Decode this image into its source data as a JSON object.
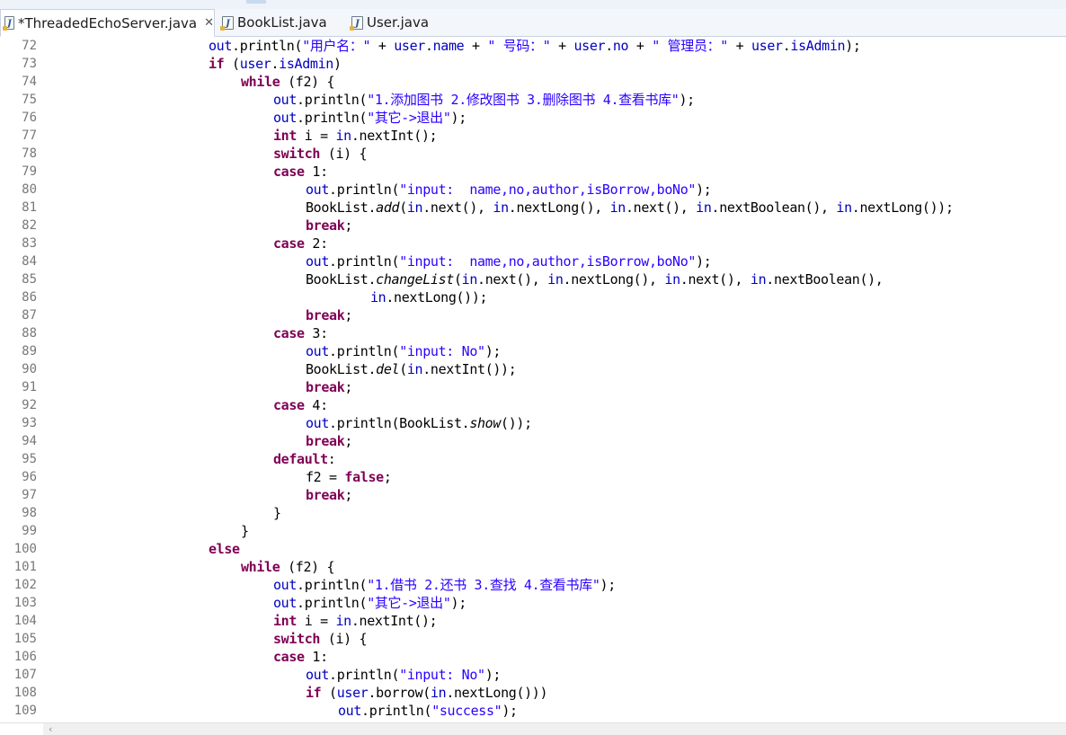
{
  "tabs": [
    {
      "label": "*ThreadedEchoServer.java",
      "active": true,
      "closable": true
    },
    {
      "label": "BookList.java",
      "active": false,
      "closable": false
    },
    {
      "label": "User.java",
      "active": false,
      "closable": false
    }
  ],
  "colors": {
    "keyword": "#7f0055",
    "field": "#0000c0",
    "string": "#2a00ff",
    "line_number": "#787878"
  },
  "lines": [
    {
      "n": "72",
      "indent": 5,
      "t": [
        [
          "out",
          "f"
        ],
        [
          ".println("
        ],
        [
          "\"用户名：\"",
          "s"
        ],
        [
          " + "
        ],
        [
          "user",
          "f"
        ],
        [
          "."
        ],
        [
          "name",
          "f"
        ],
        [
          " + "
        ],
        [
          "\" 号码：\"",
          "s"
        ],
        [
          " + "
        ],
        [
          "user",
          "f"
        ],
        [
          "."
        ],
        [
          "no",
          "f"
        ],
        [
          " + "
        ],
        [
          "\" 管理员：\"",
          "s"
        ],
        [
          " + "
        ],
        [
          "user",
          "f"
        ],
        [
          "."
        ],
        [
          "isAdmin",
          "f"
        ],
        [
          ");"
        ]
      ]
    },
    {
      "n": "73",
      "indent": 5,
      "t": [
        [
          "if",
          "k"
        ],
        [
          " ("
        ],
        [
          "user",
          "f"
        ],
        [
          "."
        ],
        [
          "isAdmin",
          "f"
        ],
        [
          ")"
        ]
      ]
    },
    {
      "n": "74",
      "indent": 6,
      "t": [
        [
          "while",
          "k"
        ],
        [
          " (f2) {"
        ]
      ]
    },
    {
      "n": "75",
      "indent": 7,
      "t": [
        [
          "out",
          "f"
        ],
        [
          ".println("
        ],
        [
          "\"1.添加图书 2.修改图书 3.删除图书 4.查看书库\"",
          "s"
        ],
        [
          ");"
        ]
      ]
    },
    {
      "n": "76",
      "indent": 7,
      "t": [
        [
          "out",
          "f"
        ],
        [
          ".println("
        ],
        [
          "\"其它->退出\"",
          "s"
        ],
        [
          ");"
        ]
      ]
    },
    {
      "n": "77",
      "indent": 7,
      "t": [
        [
          "int",
          "k"
        ],
        [
          " i = "
        ],
        [
          "in",
          "f"
        ],
        [
          ".nextInt();"
        ]
      ]
    },
    {
      "n": "78",
      "indent": 7,
      "t": [
        [
          "switch",
          "k"
        ],
        [
          " (i) {"
        ]
      ]
    },
    {
      "n": "79",
      "indent": 7,
      "t": [
        [
          "case",
          "k"
        ],
        [
          " 1:"
        ]
      ]
    },
    {
      "n": "80",
      "indent": 8,
      "t": [
        [
          "out",
          "f"
        ],
        [
          ".println("
        ],
        [
          "\"input:  name,no,author,isBorrow,boNo\"",
          "s"
        ],
        [
          ");"
        ]
      ]
    },
    {
      "n": "81",
      "indent": 8,
      "t": [
        [
          "BookList."
        ],
        [
          "add",
          "i"
        ],
        [
          "("
        ],
        [
          "in",
          "f"
        ],
        [
          ".next(), "
        ],
        [
          "in",
          "f"
        ],
        [
          ".nextLong(), "
        ],
        [
          "in",
          "f"
        ],
        [
          ".next(), "
        ],
        [
          "in",
          "f"
        ],
        [
          ".nextBoolean(), "
        ],
        [
          "in",
          "f"
        ],
        [
          ".nextLong());"
        ]
      ]
    },
    {
      "n": "82",
      "indent": 8,
      "t": [
        [
          "break",
          "k"
        ],
        [
          ";"
        ]
      ]
    },
    {
      "n": "83",
      "indent": 7,
      "t": [
        [
          "case",
          "k"
        ],
        [
          " 2:"
        ]
      ]
    },
    {
      "n": "84",
      "indent": 8,
      "t": [
        [
          "out",
          "f"
        ],
        [
          ".println("
        ],
        [
          "\"input:  name,no,author,isBorrow,boNo\"",
          "s"
        ],
        [
          ");"
        ]
      ]
    },
    {
      "n": "85",
      "indent": 8,
      "t": [
        [
          "BookList."
        ],
        [
          "changeList",
          "i"
        ],
        [
          "("
        ],
        [
          "in",
          "f"
        ],
        [
          ".next(), "
        ],
        [
          "in",
          "f"
        ],
        [
          ".nextLong(), "
        ],
        [
          "in",
          "f"
        ],
        [
          ".next(), "
        ],
        [
          "in",
          "f"
        ],
        [
          ".nextBoolean(),"
        ]
      ]
    },
    {
      "n": "86",
      "indent": 10,
      "t": [
        [
          "in",
          "f"
        ],
        [
          ".nextLong());"
        ]
      ]
    },
    {
      "n": "87",
      "indent": 8,
      "t": [
        [
          "break",
          "k"
        ],
        [
          ";"
        ]
      ]
    },
    {
      "n": "88",
      "indent": 7,
      "t": [
        [
          "case",
          "k"
        ],
        [
          " 3:"
        ]
      ]
    },
    {
      "n": "89",
      "indent": 8,
      "t": [
        [
          "out",
          "f"
        ],
        [
          ".println("
        ],
        [
          "\"input: No\"",
          "s"
        ],
        [
          ");"
        ]
      ]
    },
    {
      "n": "90",
      "indent": 8,
      "t": [
        [
          "BookList."
        ],
        [
          "del",
          "i"
        ],
        [
          "("
        ],
        [
          "in",
          "f"
        ],
        [
          ".nextInt());"
        ]
      ]
    },
    {
      "n": "91",
      "indent": 8,
      "t": [
        [
          "break",
          "k"
        ],
        [
          ";"
        ]
      ]
    },
    {
      "n": "92",
      "indent": 7,
      "t": [
        [
          "case",
          "k"
        ],
        [
          " 4:"
        ]
      ]
    },
    {
      "n": "93",
      "indent": 8,
      "t": [
        [
          "out",
          "f"
        ],
        [
          ".println(BookList."
        ],
        [
          "show",
          "i"
        ],
        [
          "());"
        ]
      ]
    },
    {
      "n": "94",
      "indent": 8,
      "t": [
        [
          "break",
          "k"
        ],
        [
          ";"
        ]
      ]
    },
    {
      "n": "95",
      "indent": 7,
      "t": [
        [
          "default",
          "k"
        ],
        [
          ":"
        ]
      ]
    },
    {
      "n": "96",
      "indent": 8,
      "t": [
        [
          "f2 = "
        ],
        [
          "false",
          "k"
        ],
        [
          ";"
        ]
      ]
    },
    {
      "n": "97",
      "indent": 8,
      "t": [
        [
          "break",
          "k"
        ],
        [
          ";"
        ]
      ]
    },
    {
      "n": "98",
      "indent": 7,
      "t": [
        [
          "}"
        ]
      ]
    },
    {
      "n": "99",
      "indent": 6,
      "t": [
        [
          "}"
        ]
      ]
    },
    {
      "n": "100",
      "indent": 5,
      "t": [
        [
          "else",
          "k"
        ]
      ]
    },
    {
      "n": "101",
      "indent": 6,
      "t": [
        [
          "while",
          "k"
        ],
        [
          " (f2) {"
        ]
      ]
    },
    {
      "n": "102",
      "indent": 7,
      "t": [
        [
          "out",
          "f"
        ],
        [
          ".println("
        ],
        [
          "\"1.借书 2.还书 3.查找 4.查看书库\"",
          "s"
        ],
        [
          ");"
        ]
      ]
    },
    {
      "n": "103",
      "indent": 7,
      "t": [
        [
          "out",
          "f"
        ],
        [
          ".println("
        ],
        [
          "\"其它->退出\"",
          "s"
        ],
        [
          ");"
        ]
      ]
    },
    {
      "n": "104",
      "indent": 7,
      "t": [
        [
          "int",
          "k"
        ],
        [
          " i = "
        ],
        [
          "in",
          "f"
        ],
        [
          ".nextInt();"
        ]
      ]
    },
    {
      "n": "105",
      "indent": 7,
      "t": [
        [
          "switch",
          "k"
        ],
        [
          " (i) {"
        ]
      ]
    },
    {
      "n": "106",
      "indent": 7,
      "t": [
        [
          "case",
          "k"
        ],
        [
          " 1:"
        ]
      ]
    },
    {
      "n": "107",
      "indent": 8,
      "t": [
        [
          "out",
          "f"
        ],
        [
          ".println("
        ],
        [
          "\"input: No\"",
          "s"
        ],
        [
          ");"
        ]
      ]
    },
    {
      "n": "108",
      "indent": 8,
      "t": [
        [
          "if",
          "k"
        ],
        [
          " ("
        ],
        [
          "user",
          "f"
        ],
        [
          ".borrow("
        ],
        [
          "in",
          "f"
        ],
        [
          ".nextLong()))"
        ]
      ]
    },
    {
      "n": "109",
      "indent": 9,
      "t": [
        [
          "out",
          "f"
        ],
        [
          ".println("
        ],
        [
          "\"success\"",
          "s"
        ],
        [
          ");"
        ]
      ]
    }
  ],
  "scrollbar": {
    "left_arrow": "‹"
  }
}
